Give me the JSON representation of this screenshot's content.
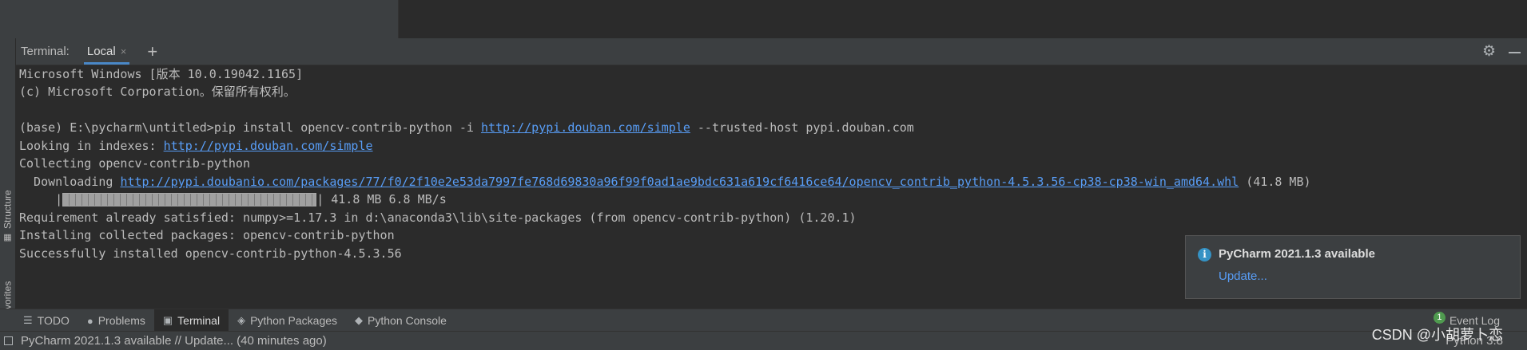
{
  "terminal": {
    "title": "Terminal:",
    "tab_label": "Local",
    "close_glyph": "×",
    "add_glyph": "+",
    "lines": {
      "l1": "Microsoft Windows [版本 10.0.19042.1165]",
      "l2": "(c) Microsoft Corporation。保留所有权利。",
      "l3_prefix": "(base) E:\\pycharm\\untitled>pip install opencv-contrib-python -i ",
      "l3_link": "http://pypi.douban.com/simple",
      "l3_suffix": " --trusted-host pypi.douban.com",
      "l4_prefix": "Looking in indexes: ",
      "l4_link": "http://pypi.douban.com/simple",
      "l5": "Collecting opencv-contrib-python",
      "l6_prefix": "  Downloading ",
      "l6_link": "http://pypi.doubanio.com/packages/77/f0/2f10e2e53da7997fe768d69830a96f99f0ad1ae9bdc631a619cf6416ce64/opencv_contrib_python-4.5.3.56-cp38-cp38-win_amd64.whl",
      "l6_suffix": " (41.8 MB)",
      "l7_indent": "     |",
      "l7_suffix": "| 41.8 MB 6.8 MB/s",
      "l8": "Requirement already satisfied: numpy>=1.17.3 in d:\\anaconda3\\lib\\site-packages (from opencv-contrib-python) (1.20.1)",
      "l9": "Installing collected packages: opencv-contrib-python",
      "l10": "Successfully installed opencv-contrib-python-4.5.3.56"
    },
    "progress": 1.0
  },
  "side_tabs": {
    "structure": "Structure",
    "favorites": "Favorites"
  },
  "notification": {
    "title": "PyCharm 2021.1.3 available",
    "action": "Update..."
  },
  "toolwindows": {
    "todo": "TODO",
    "problems": "Problems",
    "terminal": "Terminal",
    "python_packages": "Python Packages",
    "python_console": "Python Console",
    "event_log": "Event Log",
    "event_count": "1"
  },
  "status": {
    "message": "PyCharm 2021.1.3 available // Update... (40 minutes ago)",
    "interpreter": "Python 3.8"
  },
  "watermark": "CSDN @小胡萝卜恋",
  "colors": {
    "background": "#2b2b2b",
    "panel": "#3c3f41",
    "link": "#589df6",
    "accent": "#4a88c7"
  },
  "icons": {
    "settings": "gear-icon",
    "minimize": "minimize-icon",
    "info": "info-icon"
  }
}
